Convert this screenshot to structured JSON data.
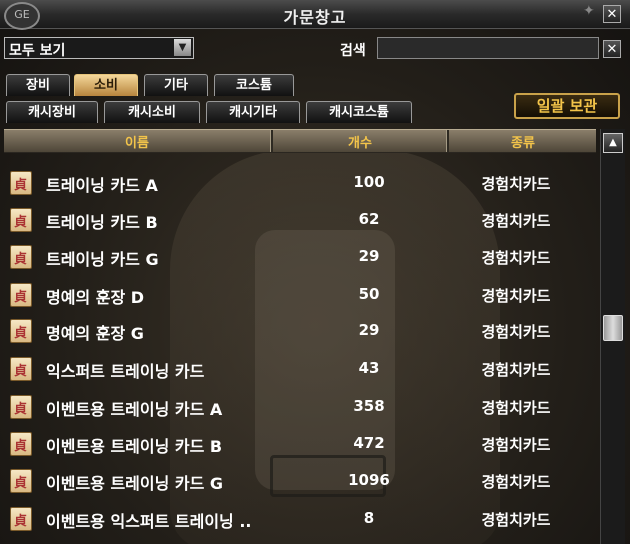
{
  "window": {
    "title": "가문창고",
    "logo_text": "GE"
  },
  "filter": {
    "selected": "모두 보기"
  },
  "search": {
    "label": "검색",
    "value": ""
  },
  "tabs_row1": [
    "장비",
    "소비",
    "기타",
    "코스튬"
  ],
  "tabs_row2": [
    "캐시장비",
    "캐시소비",
    "캐시기타",
    "캐시코스튬"
  ],
  "active_tab": "소비",
  "bulk_button": "일괄 보관",
  "columns": [
    "이름",
    "개수",
    "종류"
  ],
  "items": [
    {
      "name": "트레이닝 카드 A",
      "count": "100",
      "type": "경험치카드"
    },
    {
      "name": "트레이닝 카드 B",
      "count": "62",
      "type": "경험치카드"
    },
    {
      "name": "트레이닝 카드 G",
      "count": "29",
      "type": "경험치카드"
    },
    {
      "name": "명예의 훈장 D",
      "count": "50",
      "type": "경험치카드"
    },
    {
      "name": "명예의 훈장 G",
      "count": "29",
      "type": "경험치카드"
    },
    {
      "name": "익스퍼트 트레이닝 카드",
      "count": "43",
      "type": "경험치카드"
    },
    {
      "name": "이벤트용 트레이닝 카드 A",
      "count": "358",
      "type": "경험치카드"
    },
    {
      "name": "이벤트용 트레이닝 카드 B",
      "count": "472",
      "type": "경험치카드"
    },
    {
      "name": "이벤트용 트레이닝 카드 G",
      "count": "1096",
      "type": "경험치카드"
    },
    {
      "name": "이벤트용 익스퍼트 트레이닝 ..",
      "count": "8",
      "type": "경험치카드"
    }
  ],
  "icons": {
    "item": "scroll-card-icon",
    "close": "close-icon",
    "dropdown": "chevron-down-icon",
    "scroll_up": "arrow-up-icon"
  }
}
